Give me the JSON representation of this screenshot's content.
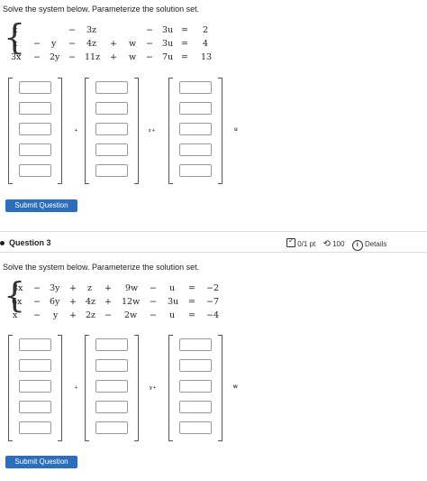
{
  "q1": {
    "instruction": "Solve the system below. Parameterize the solution set.",
    "rows": [
      [
        "x",
        "",
        "",
        "−",
        "3z",
        "",
        "",
        "−",
        "3u",
        "=",
        "2"
      ],
      [
        "x",
        "−",
        "y",
        "−",
        "4z",
        "+",
        "w",
        "−",
        "3u",
        "=",
        "4"
      ],
      [
        "3x",
        "−",
        "2y",
        "−",
        "11z",
        "+",
        "w",
        "−",
        "7u",
        "=",
        "13"
      ]
    ],
    "vector_ops": [
      "+",
      "z +",
      "u"
    ],
    "submit_label": "Submit Question"
  },
  "q2": {
    "title": "Question 3",
    "score": "0/1 pt",
    "attempts": "100",
    "details": "Details",
    "instruction": "Solve the system below. Parameterize the solution set.",
    "rows": [
      [
        "3x",
        "−",
        "3y",
        "+",
        "z",
        "+",
        "9w",
        "−",
        "u",
        "=",
        "−2"
      ],
      [
        "6x",
        "−",
        "6y",
        "+",
        "4z",
        "+",
        "12w",
        "−",
        "3u",
        "=",
        "−7"
      ],
      [
        "x",
        "−",
        "y",
        "+",
        "2z",
        "−",
        "2w",
        "−",
        "u",
        "=",
        "−4"
      ]
    ],
    "vector_ops": [
      "+",
      "y +",
      "w"
    ],
    "submit_label": "Submit Question"
  },
  "icons": [
    "checkbox-icon",
    "retry-icon",
    "info-icon"
  ],
  "colors": {
    "button": "#2a6ebd",
    "button_text": "#ffffff"
  }
}
